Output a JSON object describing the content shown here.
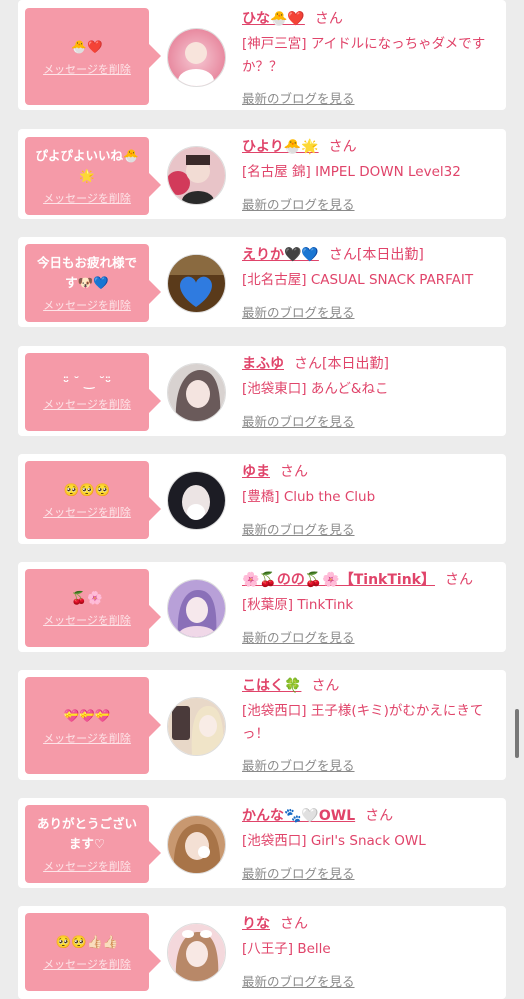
{
  "cards": [
    {
      "message": "🐣❤️",
      "delete_label": "メッセージを削除",
      "name": "ひな🐣❤️",
      "honorific": "さん",
      "status": "",
      "shop": "[神戸三宮] アイドルになっちゃダメですか？？",
      "blog_link": "最新のブログを見る",
      "avatar_colors": [
        "#f6c9d4",
        "#e88aa0"
      ]
    },
    {
      "message": "ぴよぴよいいね🐣🌟",
      "delete_label": "メッセージを削除",
      "name": "ひより🐣🌟",
      "honorific": "さん",
      "status": "",
      "shop": "[名古屋 錦] IMPEL DOWN Level32",
      "blog_link": "最新のブログを見る",
      "avatar_colors": [
        "#3a2a2a",
        "#e8c4c8"
      ]
    },
    {
      "message": "今日もお疲れ様です🐶💙",
      "delete_label": "メッセージを削除",
      "name": "えりか🖤💙",
      "honorific": "さん",
      "status": "[本日出勤]",
      "shop": "[北名古屋] CASUAL SNACK PARFAIT",
      "blog_link": "最新のブログを見る",
      "avatar_colors": [
        "#5a3a1a",
        "#2f7be0"
      ]
    },
    {
      "message": "ᵕ̈ ˘ ‿ ˘ᵕ̈",
      "delete_label": "メッセージを削除",
      "name": "まふゆ",
      "honorific": "さん",
      "status": "[本日出勤]",
      "shop": "[池袋東口] あんど&ねこ",
      "blog_link": "最新のブログを見る",
      "avatar_colors": [
        "#d8d2d0",
        "#6a5a5a"
      ]
    },
    {
      "message": "🥺🥺🥺",
      "delete_label": "メッセージを削除",
      "name": "ゆま",
      "honorific": "さん",
      "status": "",
      "shop": "[豊橋] Club the Club",
      "blog_link": "最新のブログを見る",
      "avatar_colors": [
        "#1c1c24",
        "#e6e6ee"
      ]
    },
    {
      "message": "🍒🌸",
      "delete_label": "メッセージを削除",
      "name": "🌸🍒のの🍒🌸【TinkTink】",
      "honorific": "さん",
      "status": "",
      "shop": "[秋葉原] TinkTink",
      "blog_link": "最新のブログを見る",
      "avatar_colors": [
        "#b8a0d8",
        "#f0d8e8"
      ]
    },
    {
      "message": "💝💝💝",
      "delete_label": "メッセージを削除",
      "name": "こはく🍀",
      "honorific": "さん",
      "status": "",
      "shop": "[池袋西口] 王子様(キミ)がむかえにきてっ！",
      "blog_link": "最新のブログを見る",
      "avatar_colors": [
        "#e8d8c8",
        "#4a3a3a"
      ]
    },
    {
      "message": "ありがとうございます♡",
      "delete_label": "メッセージを削除",
      "name": "かんな🐾🤍OWL",
      "honorific": "さん",
      "status": "",
      "shop": "[池袋西口] Girl's Snack OWL",
      "blog_link": "最新のブログを見る",
      "avatar_colors": [
        "#c89870",
        "#f0e0d0"
      ]
    },
    {
      "message": "🥺🥺👍🏻👍🏻",
      "delete_label": "メッセージを削除",
      "name": "りな",
      "honorific": "さん",
      "status": "",
      "shop": "[八王子] Belle",
      "blog_link": "最新のブログを見る",
      "avatar_colors": [
        "#d8b8a0",
        "#f4d8dc"
      ]
    }
  ],
  "colors": {
    "accent": "#e0446a",
    "bubble": "#f59aa8",
    "background": "#ececec",
    "card": "#ffffff",
    "link_gray": "#8a8a8a"
  }
}
